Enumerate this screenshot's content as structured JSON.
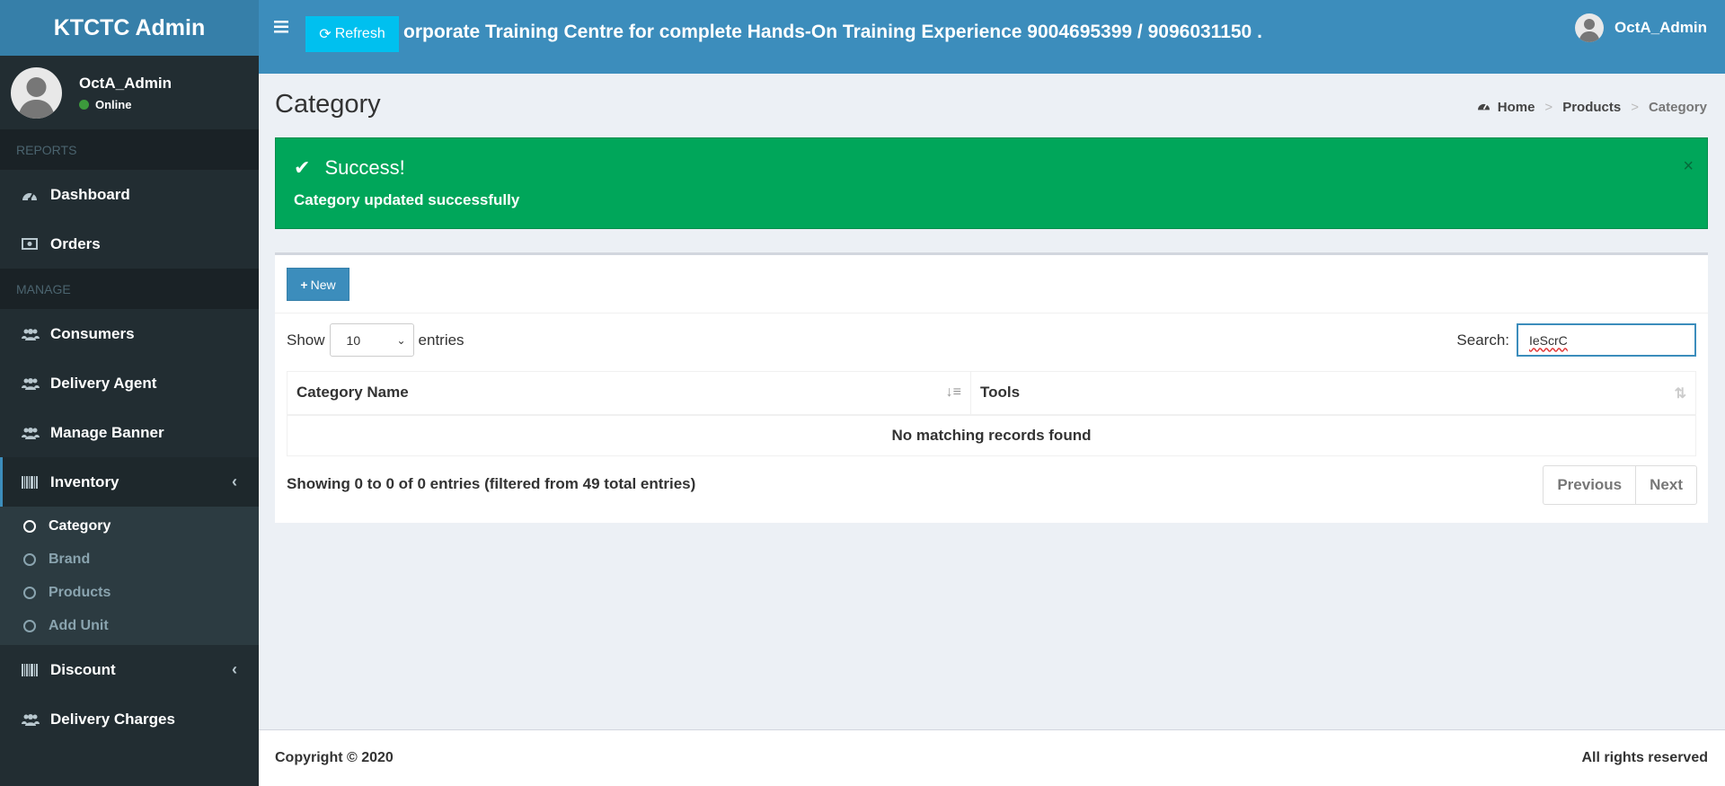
{
  "app": {
    "logo": "KTCTC Admin"
  },
  "user": {
    "name": "OctA_Admin",
    "status": "Online"
  },
  "sidebar": {
    "sections": [
      {
        "header": "REPORTS",
        "items": [
          {
            "label": "Dashboard",
            "icon": "dashboard-icon"
          },
          {
            "label": "Orders",
            "icon": "money-icon"
          }
        ]
      },
      {
        "header": "MANAGE",
        "items": [
          {
            "label": "Consumers",
            "icon": "users-icon"
          },
          {
            "label": "Delivery Agent",
            "icon": "users-icon"
          },
          {
            "label": "Manage Banner",
            "icon": "users-icon"
          }
        ]
      }
    ],
    "inventory": {
      "label": "Inventory",
      "sub": [
        "Category",
        "Brand",
        "Products",
        "Add Unit"
      ]
    },
    "discount": {
      "label": "Discount"
    },
    "delivery": {
      "label": "Delivery Charges"
    }
  },
  "header": {
    "refresh_label": "Refresh",
    "marquee": "orporate Training Centre for complete Hands-On Training Experience 9004695399 / 9096031150 ."
  },
  "page": {
    "title": "Category",
    "breadcrumb": [
      "Home",
      "Products",
      "Category"
    ]
  },
  "alert": {
    "title": "Success!",
    "message": "Category updated successfully",
    "close": "×"
  },
  "table_controls": {
    "new_label": "New",
    "show_label": "Show",
    "entries_label": "entries",
    "page_length": "10",
    "search_label": "Search:",
    "search_value": "IeScrC"
  },
  "table": {
    "columns": [
      "Category Name",
      "Tools"
    ],
    "empty": "No matching records found",
    "info": "Showing 0 to 0 of 0 entries (filtered from 49 total entries)",
    "prev": "Previous",
    "next": "Next"
  },
  "footer": {
    "copyright": "Copyright © 2020",
    "rights": "All rights reserved"
  },
  "colors": {
    "header": "#3c8dbc",
    "sidebar": "#222d32",
    "success": "#00a65a",
    "refresh": "#00c0ef"
  }
}
